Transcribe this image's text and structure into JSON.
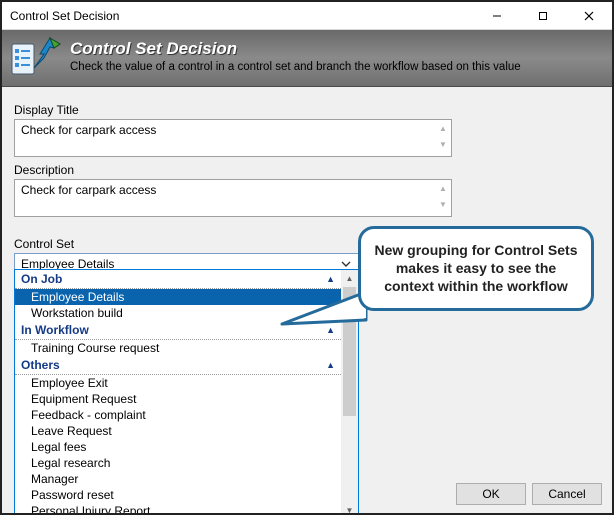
{
  "window": {
    "title": "Control Set Decision"
  },
  "banner": {
    "title": "Control Set Decision",
    "subtitle": "Check the value of a control in a control set and branch the workflow based on this value"
  },
  "fields": {
    "display_title_label": "Display Title",
    "display_title_value": "Check for carpark access",
    "description_label": "Description",
    "description_value": "Check for carpark access",
    "control_set_label": "Control Set",
    "control_set_selected": "Employee Details"
  },
  "dropdown": {
    "groups": [
      {
        "header": "On Job",
        "items": [
          {
            "label": "Employee Details",
            "selected": true
          },
          {
            "label": "Workstation build",
            "selected": false
          }
        ]
      },
      {
        "header": "In Workflow",
        "items": [
          {
            "label": "Training Course request",
            "selected": false
          }
        ]
      },
      {
        "header": "Others",
        "items": [
          {
            "label": "Employee Exit",
            "selected": false
          },
          {
            "label": "Equipment Request",
            "selected": false
          },
          {
            "label": "Feedback - complaint",
            "selected": false
          },
          {
            "label": "Leave Request",
            "selected": false
          },
          {
            "label": "Legal fees",
            "selected": false
          },
          {
            "label": "Legal research",
            "selected": false
          },
          {
            "label": "Manager",
            "selected": false
          },
          {
            "label": "Password reset",
            "selected": false
          },
          {
            "label": "Personal Injury Report",
            "selected": false
          }
        ]
      }
    ]
  },
  "callout": {
    "text": "New grouping for Control Sets makes it easy to see the context within the workflow"
  },
  "buttons": {
    "ok": "OK",
    "cancel": "Cancel"
  }
}
